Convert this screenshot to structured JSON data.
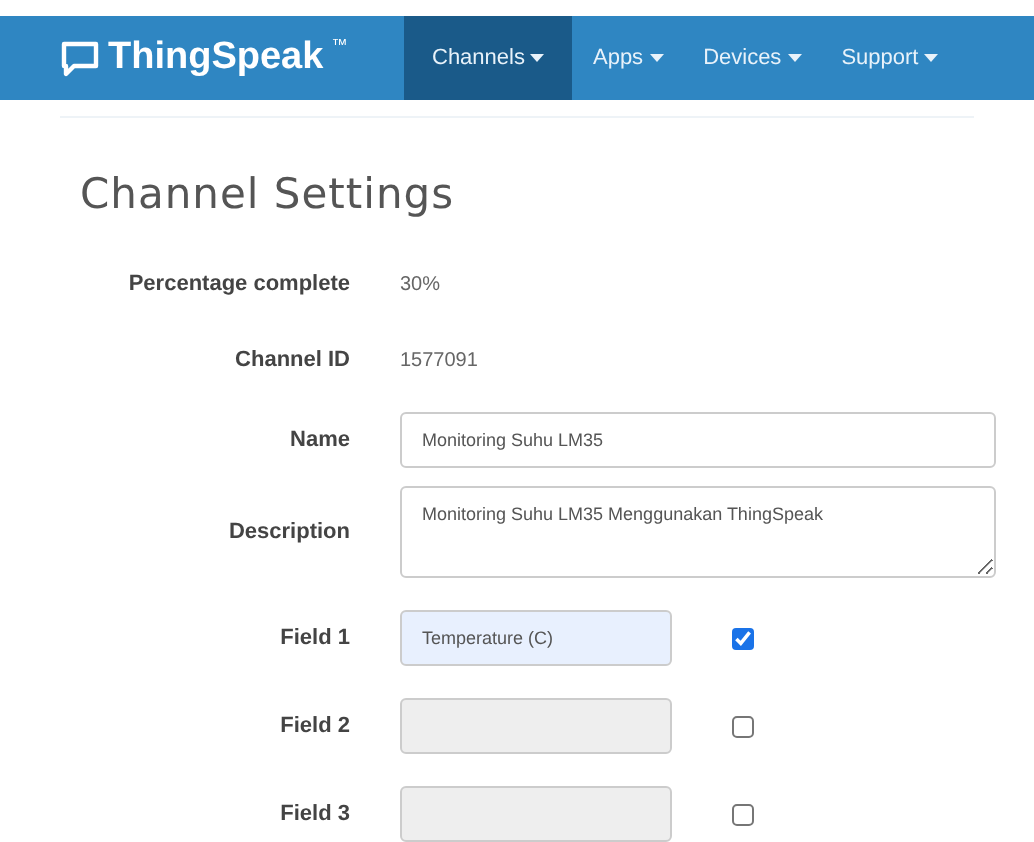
{
  "navbar": {
    "logo": "ThingSpeak",
    "trademark": "™",
    "menus": [
      {
        "label": "Channels",
        "selected": true
      },
      {
        "label": "Apps",
        "selected": false
      },
      {
        "label": "Devices",
        "selected": false
      },
      {
        "label": "Support",
        "selected": false
      }
    ]
  },
  "page_title": "Channel Settings",
  "info": [
    {
      "label": "Percentage complete",
      "value": "30%"
    },
    {
      "label": "Channel ID",
      "value": "1577091"
    }
  ],
  "name": {
    "label": "Name",
    "value": "Monitoring Suhu LM35"
  },
  "description": {
    "label": "Description",
    "value": "Monitoring Suhu LM35 Menggunakan ThingSpeak"
  },
  "fields": [
    {
      "label": "Field 1",
      "value": "Temperature (C)",
      "checked": true,
      "disabled": false
    },
    {
      "label": "Field 2",
      "checked": false,
      "disabled": true
    },
    {
      "label": "Field 3",
      "checked": false,
      "disabled": true
    }
  ]
}
